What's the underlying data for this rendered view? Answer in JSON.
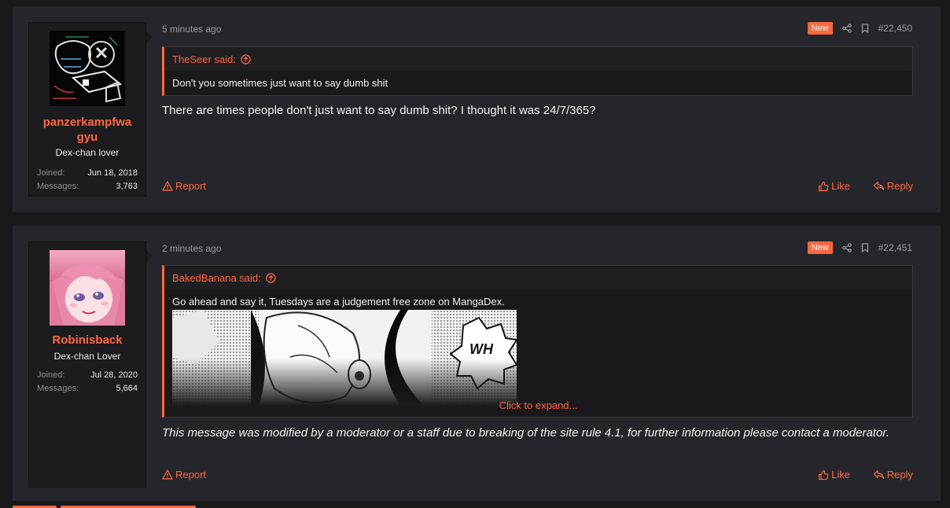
{
  "posts": [
    {
      "time": "5 minutes ago",
      "badge": "New",
      "number": "#22,450",
      "username_line1": "panzerkampfwa",
      "username_line2": "gyu",
      "user_title": "Dex-chan lover",
      "joined_label": "Joined:",
      "joined": "Jun 18, 2018",
      "messages_label": "Messages:",
      "messages": "3,763",
      "quote_author": "TheSeer said:",
      "quote_text": "Don't you sometimes just want to say dumb shit",
      "message": "There are times people don't just want to say dumb shit? I thought it was 24/7/365?",
      "report": "Report",
      "like": "Like",
      "reply": "Reply"
    },
    {
      "time": "2 minutes ago",
      "badge": "New",
      "number": "#22,451",
      "username": "Robinisback",
      "user_title": "Dex-chan Lover",
      "joined_label": "Joined:",
      "joined": "Jul 28, 2020",
      "messages_label": "Messages:",
      "messages": "5,664",
      "quote_author": "BakedBanana said:",
      "quote_text": "Go ahead and say it, Tuesdays are a judgement free zone on MangaDex.",
      "quote_image_text": "WH",
      "expand": "Click to expand...",
      "message": "This message was modified by a moderator or a staff due to breaking of the site rule 4.1, for further information please contact a moderator.",
      "report": "Report",
      "like": "Like",
      "reply": "Reply"
    }
  ],
  "colors": {
    "accent": "#ff6740",
    "panel": "#25262b",
    "background": "#19191c"
  },
  "icons": [
    "share-icon",
    "bookmark-icon",
    "arrow-up-circle-icon",
    "warning-icon",
    "thumbs-up-icon",
    "reply-icon"
  ]
}
